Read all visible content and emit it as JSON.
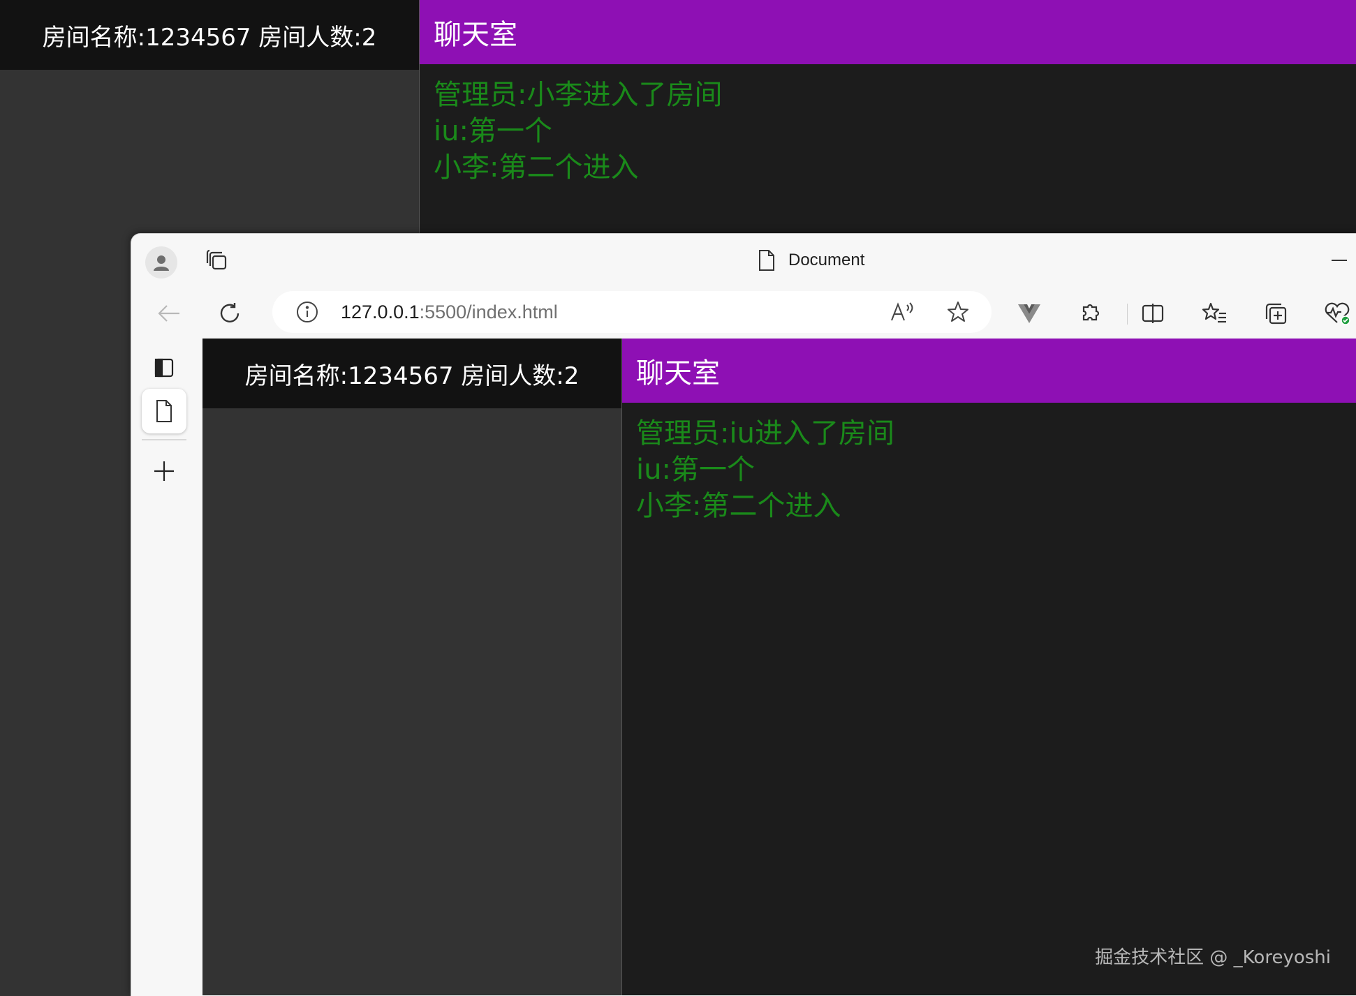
{
  "background_app": {
    "room_info": "房间名称:1234567 房间人数:2",
    "chat_title": "聊天室",
    "messages": [
      "管理员:小李进入了房间",
      "iu:第一个",
      "小李:第二个进入"
    ]
  },
  "browser": {
    "tab_title": "Document",
    "url_host": "127.0.0.1",
    "url_rest": ":5500/index.html",
    "icons": {
      "profile": "profile-icon",
      "tab_actions": "tab-actions-icon",
      "back": "back-arrow-icon",
      "refresh": "refresh-icon",
      "info": "info-icon",
      "read_aloud": "read-aloud-icon",
      "favorite": "star-icon",
      "vue_devtools": "vue-devtools-icon",
      "extensions": "extensions-icon",
      "split_screen": "split-screen-icon",
      "favorites": "favorites-icon",
      "collections": "collections-icon",
      "browser_essentials": "browser-essentials-icon",
      "minimize": "minimize-icon",
      "vertical_tabs": "vertical-tabs-icon",
      "tab_document": "document-icon",
      "new_tab": "plus-icon"
    }
  },
  "foreground_app": {
    "room_info": "房间名称:1234567 房间人数:2",
    "chat_title": "聊天室",
    "messages": [
      "管理员:iu进入了房间",
      "iu:第一个",
      "小李:第二个进入"
    ]
  },
  "watermark": "掘金技术社区 @ _Koreyoshi",
  "colors": {
    "chat_header": "#8e10b4",
    "message_text": "#1a8a1a",
    "room_header": "#121212",
    "panel_bg": "#333333",
    "chat_bg": "#1c1c1c",
    "browser_chrome": "#f7f7f7"
  }
}
